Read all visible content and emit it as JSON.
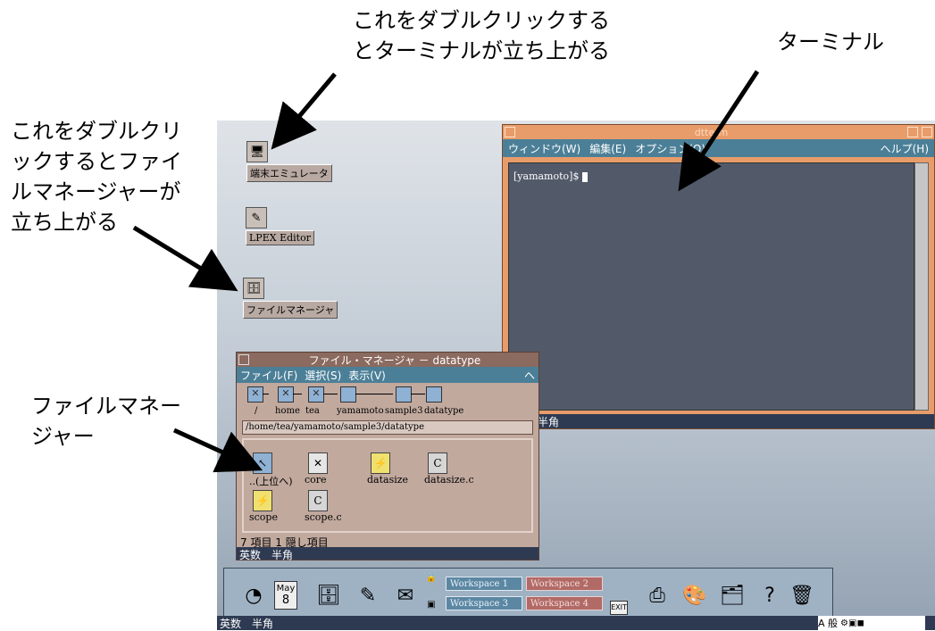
{
  "annotations": {
    "top": "これをダブルクリックする\nとターミナルが立ち上がる",
    "top_right": "ターミナル",
    "left_top": "これをダブルクリ\nックするとファイ\nルマネージャーが\n立ち上がる",
    "left_bottom": "ファイルマネー\nジャー"
  },
  "desktop_icons": {
    "terminal": "端末エミュレータ",
    "lpex": "LPEX Editor",
    "filemanager": "ファイルマネージャ"
  },
  "terminal": {
    "title": "dtterm",
    "menu": [
      "ウィンドウ(W)",
      "編集(E)",
      "オプション(O)"
    ],
    "help": "ヘルプ(H)",
    "prompt": "[yamamoto]$",
    "ime": "英数　半角"
  },
  "filemanager": {
    "title": "ファイル・マネージャ － datatype",
    "menu": [
      "ファイル(F)",
      "選択(S)",
      "表示(V)"
    ],
    "help": "ヘ",
    "path_labels": [
      "/",
      "home",
      "tea",
      "yamamoto",
      "sample3",
      "datatype"
    ],
    "current_path": "/home/tea/yamamoto/sample3/datatype",
    "files": [
      {
        "name": "..(上位へ)",
        "icon": "folder-up-icon"
      },
      {
        "name": "core",
        "icon": "core-file-icon"
      },
      {
        "name": "datasize",
        "icon": "executable-icon"
      },
      {
        "name": "datasize.c",
        "icon": "c-source-icon"
      },
      {
        "name": "scope",
        "icon": "executable-icon"
      },
      {
        "name": "scope.c",
        "icon": "c-source-icon"
      }
    ],
    "status": "7 項目 1 隠し項目",
    "ime": "英数　半角"
  },
  "panel": {
    "date_month": "May",
    "date_day": "8",
    "workspaces": [
      "Workspace  1",
      "Workspace  2",
      "Workspace  3",
      "Workspace  4"
    ],
    "exit": "EXIT"
  },
  "bottom_ime": "英数　半角",
  "tray": "A 般"
}
